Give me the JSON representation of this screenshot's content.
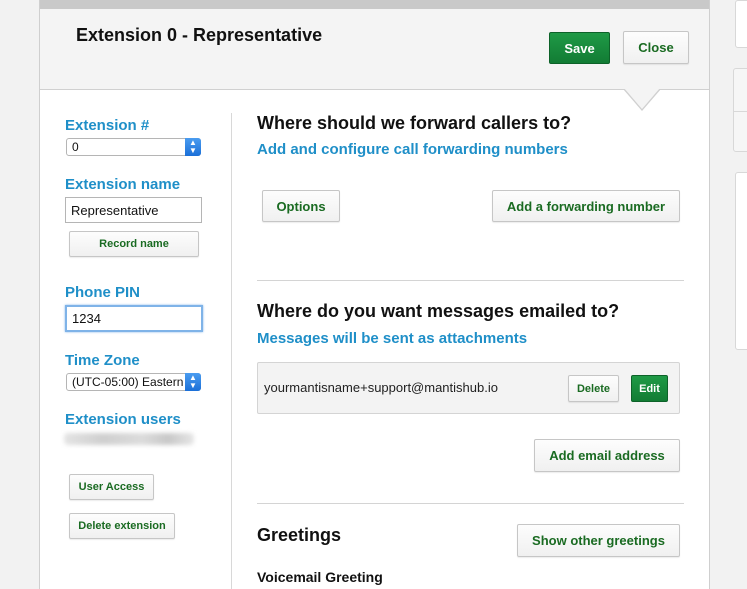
{
  "header": {
    "title": "Extension 0 - Representative",
    "save_label": "Save",
    "close_label": "Close"
  },
  "sidebar": {
    "extension_number_label": "Extension #",
    "extension_number_value": "0",
    "extension_name_label": "Extension name",
    "extension_name_value": "Representative",
    "record_name_label": "Record name",
    "phone_pin_label": "Phone PIN",
    "phone_pin_value": "1234",
    "time_zone_label": "Time Zone",
    "time_zone_value": "(UTC-05:00) Eastern",
    "extension_users_label": "Extension users",
    "user_access_label": "User Access",
    "delete_extension_label": "Delete extension"
  },
  "forwarding": {
    "title": "Where should we forward callers to?",
    "subtitle": "Add and configure call forwarding numbers",
    "options_label": "Options",
    "add_number_label": "Add a forwarding number"
  },
  "email": {
    "title": "Where do you want messages emailed to?",
    "subtitle": "Messages will be sent as attachments",
    "address": "yourmantisname+support@mantishub.io",
    "delete_label": "Delete",
    "edit_label": "Edit",
    "add_email_label": "Add email address"
  },
  "greetings": {
    "title": "Greetings",
    "show_other_label": "Show other greetings",
    "voicemail_label": "Voicemail Greeting"
  },
  "colors": {
    "accent_blue": "#1f8fc8",
    "primary_green": "#127c34",
    "link_green": "#1a6b22"
  }
}
